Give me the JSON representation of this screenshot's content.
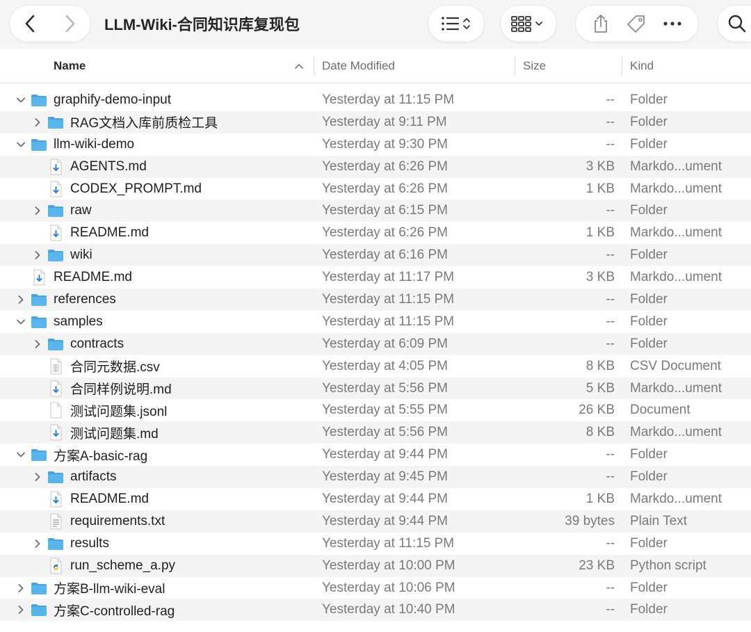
{
  "window": {
    "title": "LLM-Wiki-合同知识库复现包"
  },
  "columns": {
    "name": "Name",
    "date": "Date Modified",
    "size": "Size",
    "kind": "Kind"
  },
  "rows": [
    {
      "name": "graphify-demo-input",
      "date": "Yesterday at 11:15 PM",
      "size": "--",
      "kind": "Folder",
      "depth": 0,
      "type": "folder",
      "chevron": "expanded"
    },
    {
      "name": "RAG文档入库前质检工具",
      "date": "Yesterday at 9:11 PM",
      "size": "--",
      "kind": "Folder",
      "depth": 1,
      "type": "folder",
      "chevron": "collapsed"
    },
    {
      "name": "llm-wiki-demo",
      "date": "Yesterday at 9:30 PM",
      "size": "--",
      "kind": "Folder",
      "depth": 0,
      "type": "folder",
      "chevron": "expanded"
    },
    {
      "name": "AGENTS.md",
      "date": "Yesterday at 6:26 PM",
      "size": "3 KB",
      "kind": "Markdo...ument",
      "depth": 1,
      "type": "markdown",
      "chevron": "none"
    },
    {
      "name": "CODEX_PROMPT.md",
      "date": "Yesterday at 6:26 PM",
      "size": "1 KB",
      "kind": "Markdo...ument",
      "depth": 1,
      "type": "markdown",
      "chevron": "none"
    },
    {
      "name": "raw",
      "date": "Yesterday at 6:15 PM",
      "size": "--",
      "kind": "Folder",
      "depth": 1,
      "type": "folder",
      "chevron": "collapsed"
    },
    {
      "name": "README.md",
      "date": "Yesterday at 6:26 PM",
      "size": "1 KB",
      "kind": "Markdo...ument",
      "depth": 1,
      "type": "markdown",
      "chevron": "none"
    },
    {
      "name": "wiki",
      "date": "Yesterday at 6:16 PM",
      "size": "--",
      "kind": "Folder",
      "depth": 1,
      "type": "folder",
      "chevron": "collapsed"
    },
    {
      "name": "README.md",
      "date": "Yesterday at 11:17 PM",
      "size": "3 KB",
      "kind": "Markdo...ument",
      "depth": 0,
      "type": "markdown",
      "chevron": "none"
    },
    {
      "name": "references",
      "date": "Yesterday at 11:15 PM",
      "size": "--",
      "kind": "Folder",
      "depth": 0,
      "type": "folder",
      "chevron": "collapsed"
    },
    {
      "name": "samples",
      "date": "Yesterday at 11:15 PM",
      "size": "--",
      "kind": "Folder",
      "depth": 0,
      "type": "folder",
      "chevron": "expanded"
    },
    {
      "name": "contracts",
      "date": "Yesterday at 6:09 PM",
      "size": "--",
      "kind": "Folder",
      "depth": 1,
      "type": "folder",
      "chevron": "collapsed"
    },
    {
      "name": "合同元数据.csv",
      "date": "Yesterday at 4:05 PM",
      "size": "8 KB",
      "kind": "CSV Document",
      "depth": 1,
      "type": "csv",
      "chevron": "none"
    },
    {
      "name": "合同样例说明.md",
      "date": "Yesterday at 5:56 PM",
      "size": "5 KB",
      "kind": "Markdo...ument",
      "depth": 1,
      "type": "markdown",
      "chevron": "none"
    },
    {
      "name": "测试问题集.jsonl",
      "date": "Yesterday at 5:55 PM",
      "size": "26 KB",
      "kind": "Document",
      "depth": 1,
      "type": "document",
      "chevron": "none"
    },
    {
      "name": "测试问题集.md",
      "date": "Yesterday at 5:56 PM",
      "size": "8 KB",
      "kind": "Markdo...ument",
      "depth": 1,
      "type": "markdown",
      "chevron": "none"
    },
    {
      "name": "方案A-basic-rag",
      "date": "Yesterday at 9:44 PM",
      "size": "--",
      "kind": "Folder",
      "depth": 0,
      "type": "folder",
      "chevron": "expanded"
    },
    {
      "name": "artifacts",
      "date": "Yesterday at 9:45 PM",
      "size": "--",
      "kind": "Folder",
      "depth": 1,
      "type": "folder",
      "chevron": "collapsed"
    },
    {
      "name": "README.md",
      "date": "Yesterday at 9:44 PM",
      "size": "1 KB",
      "kind": "Markdo...ument",
      "depth": 1,
      "type": "markdown",
      "chevron": "none"
    },
    {
      "name": "requirements.txt",
      "date": "Yesterday at 9:44 PM",
      "size": "39 bytes",
      "kind": "Plain Text",
      "depth": 1,
      "type": "text",
      "chevron": "none"
    },
    {
      "name": "results",
      "date": "Yesterday at 11:15 PM",
      "size": "--",
      "kind": "Folder",
      "depth": 1,
      "type": "folder",
      "chevron": "collapsed"
    },
    {
      "name": "run_scheme_a.py",
      "date": "Yesterday at 10:00 PM",
      "size": "23 KB",
      "kind": "Python script",
      "depth": 1,
      "type": "python",
      "chevron": "none"
    },
    {
      "name": "方案B-llm-wiki-eval",
      "date": "Yesterday at 10:06 PM",
      "size": "--",
      "kind": "Folder",
      "depth": 0,
      "type": "folder",
      "chevron": "collapsed"
    },
    {
      "name": "方案C-controlled-rag",
      "date": "Yesterday at 10:40 PM",
      "size": "--",
      "kind": "Folder",
      "depth": 0,
      "type": "folder",
      "chevron": "collapsed"
    }
  ],
  "colors": {
    "folder": "#5ab4ec",
    "folder_tab": "#4aa3dd",
    "markdown_arrow": "#2f7fd6",
    "python_blue": "#3a72b0",
    "python_yellow": "#f2c53d"
  },
  "icons": {
    "back": "chevron-left-icon",
    "forward": "chevron-right-icon",
    "list_view": "list-view-icon",
    "grid_view": "grid-view-icon",
    "share": "share-icon",
    "tag": "tag-icon",
    "more": "more-icon",
    "search": "search-icon"
  }
}
